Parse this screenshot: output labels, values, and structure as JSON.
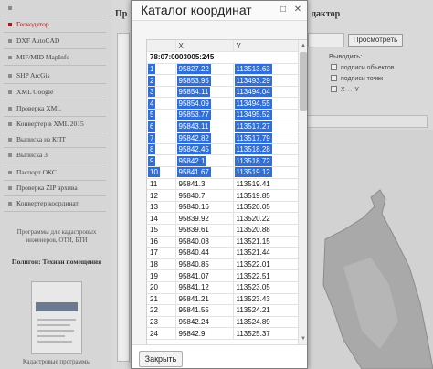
{
  "background": {
    "menu": [
      {
        "label": "",
        "active": false
      },
      {
        "label": "Геокодятор",
        "active": true
      },
      {
        "label": "DXF AutoCAD",
        "active": false
      },
      {
        "label": "MIF/MID MapInfo",
        "active": false
      },
      {
        "label": "SHP ArcGis",
        "active": false
      },
      {
        "label": "XML Google",
        "active": false
      },
      {
        "label": "Проверка XML",
        "active": false
      },
      {
        "label": "Конвертер в XML 2015",
        "active": false
      },
      {
        "label": "Выписка из КПТ",
        "active": false
      },
      {
        "label": "Выписка 3",
        "active": false
      },
      {
        "label": "Паспорт ОКС",
        "active": false
      },
      {
        "label": "Проверка ZIP архива",
        "active": false
      },
      {
        "label": "Конвертер координат",
        "active": false
      }
    ],
    "promo_text": "Программы для кадастровых инженеров, ОТИ, БТИ",
    "promo_title": "Полигон: Технан помещения",
    "promo_footer": "Кадастровые программы",
    "title_left": "Пр",
    "title_right": "дактор",
    "view_button": "Просмотреть",
    "show_label": "Выводить:",
    "options": [
      "подписи объектов",
      "подписи точек",
      "X ↔ Y"
    ]
  },
  "modal": {
    "title": "Каталог координат",
    "maximize_icon": "□",
    "close_icon": "✕",
    "columns": [
      "",
      "X",
      "Y"
    ],
    "cadastral_number": "78:07:0003005:245",
    "selected_rows": 10,
    "rows": [
      [
        "1",
        "95827.22",
        "113513.63"
      ],
      [
        "2",
        "95853.95",
        "113493.29"
      ],
      [
        "3",
        "95854.11",
        "113494.04"
      ],
      [
        "4",
        "95854.09",
        "113494.55"
      ],
      [
        "5",
        "95853.77",
        "113495.52"
      ],
      [
        "6",
        "95843.11",
        "113517.27"
      ],
      [
        "7",
        "95842.82",
        "113517.79"
      ],
      [
        "8",
        "95842.45",
        "113518.28"
      ],
      [
        "9",
        "95842.1",
        "113518.72"
      ],
      [
        "10",
        "95841.67",
        "113519.12"
      ],
      [
        "11",
        "95841.3",
        "113519.41"
      ],
      [
        "12",
        "95840.7",
        "113519.85"
      ],
      [
        "13",
        "95840.16",
        "113520.05"
      ],
      [
        "14",
        "95839.92",
        "113520.22"
      ],
      [
        "15",
        "95839.61",
        "113520.88"
      ],
      [
        "16",
        "95840.03",
        "113521.15"
      ],
      [
        "17",
        "95840.44",
        "113521.44"
      ],
      [
        "18",
        "95840.85",
        "113522.01"
      ],
      [
        "19",
        "95841.07",
        "113522.51"
      ],
      [
        "20",
        "95841.12",
        "113523.05"
      ],
      [
        "21",
        "95841.21",
        "113523.43"
      ],
      [
        "22",
        "95841.55",
        "113524.21"
      ],
      [
        "23",
        "95842.24",
        "113524.89"
      ],
      [
        "24",
        "95842.9",
        "113525.37"
      ]
    ],
    "footer_button": "Закрыть"
  }
}
